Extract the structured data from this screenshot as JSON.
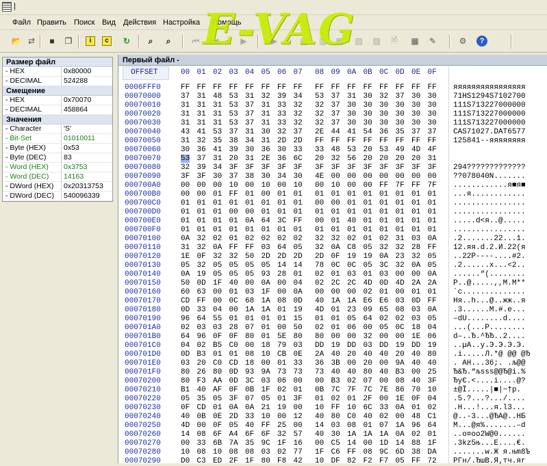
{
  "window": {
    "title": "|"
  },
  "watermark": "E-VAG",
  "menu": [
    "Файл",
    "Править",
    "Поиск",
    "Вид",
    "Действия",
    "Настройка",
    "Помощь"
  ],
  "toolbar_icons": [
    "open-file-icon",
    "compare-files-icon",
    "stop-icon",
    "copy-icon",
    "info-icon",
    "checksum-icon",
    "refresh-icon",
    "find-icon",
    "find-next-icon",
    "first-page-icon",
    "prev-page-icon",
    "prev-icon",
    "next-icon",
    "next-page-icon",
    "last-page-icon",
    "layout1-icon",
    "layout2-icon",
    "layout3-icon",
    "layout4-icon",
    "layout5-icon",
    "bookmark-icon",
    "calc-icon",
    "note-icon",
    "settings-icon",
    "help-icon"
  ],
  "left_panel": {
    "sections": [
      {
        "title": "Размер файл",
        "rows": [
          {
            "key": "- HEX",
            "value": "0x80000",
            "green": false
          },
          {
            "key": "- DECIMAL",
            "value": "524288",
            "green": false
          }
        ]
      },
      {
        "title": "Смещение",
        "rows": [
          {
            "key": "- HEX",
            "value": "0x70070",
            "green": false
          },
          {
            "key": "- DECIMAL",
            "value": "458864",
            "green": false
          }
        ]
      },
      {
        "title": "Значения",
        "rows": [
          {
            "key": "- Character",
            "value": "'S'",
            "green": false
          },
          {
            "key": "- Bit-Set",
            "value": "01010011",
            "green": true
          },
          {
            "key": "- Byte (HEX)",
            "value": "0x53",
            "green": false
          },
          {
            "key": "- Byte (DEC)",
            "value": "83",
            "green": false
          },
          {
            "key": "- Word (HEX)",
            "value": "0x3753",
            "green": true
          },
          {
            "key": "- Word (DEC)",
            "value": "14163",
            "green": true
          },
          {
            "key": "- DWord (HEX)",
            "value": "0x20313753",
            "green": false
          },
          {
            "key": "- DWord (DEC)",
            "value": "540096339",
            "green": false
          }
        ]
      }
    ]
  },
  "hex_view": {
    "title": "Первый файл -",
    "offset_header": "OFFSET",
    "columns": [
      "00",
      "01",
      "02",
      "03",
      "04",
      "05",
      "06",
      "07",
      "08",
      "09",
      "0A",
      "0B",
      "0C",
      "0D",
      "0E",
      "0F"
    ],
    "rows": [
      {
        "off": "0006FFF0",
        "bytes": "FF FF FF FF FF FF FF FF FF FF FF FF FF FF FF FF",
        "ascii": "яяяяяяяяяяяяяяяя"
      },
      {
        "off": "00070000",
        "bytes": "37 31 48 53 31 32 39 34 53 37 31 30 32 37 30 30",
        "ascii": "71HS1294S7102700"
      },
      {
        "off": "00070010",
        "bytes": "31 31 31 53 37 31 33 32 32 37 30 30 30 30 30 30",
        "ascii": "111S713227000000"
      },
      {
        "off": "00070020",
        "bytes": "31 31 31 53 37 31 33 32 32 37 30 30 30 30 30 30",
        "ascii": "111S713227000000"
      },
      {
        "off": "00070030",
        "bytes": "31 31 31 53 37 31 33 32 32 37 30 30 30 30 30 30",
        "ascii": "111S713227000000"
      },
      {
        "off": "00070040",
        "bytes": "43 41 53 37 31 30 32 37 2E 44 41 54 36 35 37 37",
        "ascii": "CAS71027.DAT6577"
      },
      {
        "off": "00070050",
        "bytes": "31 32 35 38 34 31 2D 2D FF FF FF FF FF FF FF FF",
        "ascii": "125841--яяяяяяяя"
      },
      {
        "off": "00070060",
        "bytes": "30 36 41 39 30 36 30 33 33 48 53 20 53 49 4D 4F",
        "ascii": ""
      },
      {
        "off": "00070070",
        "bytes": "53 37 31 20 31 2E 36 6C 20 32 56 20 20 20 20 31",
        "ascii": ""
      },
      {
        "off": "00070080",
        "bytes": "32 39 34 3F 3F 3F 3F 3F 3F 3F 3F 3F 3F 3F 3F 3F",
        "ascii": "294?????????????"
      },
      {
        "off": "00070090",
        "bytes": "3F 3F 30 37 38 30 34 30 4E 00 00 00 00 00 00 00",
        "ascii": "??078040N......."
      },
      {
        "off": "000700A0",
        "bytes": "00 00 00 10 00 10 00 10 00 10 00 00 FF 7F FF 7F",
        "ascii": "............я■я■"
      },
      {
        "off": "000700B0",
        "bytes": "00 00 01 FF 01 00 01 01 01 01 01 01 01 01 01 01",
        "ascii": "...я............"
      },
      {
        "off": "000700C0",
        "bytes": "01 01 01 01 01 01 01 01 00 00 01 01 01 01 01 01",
        "ascii": "................"
      },
      {
        "off": "000700D0",
        "bytes": "01 01 01 00 00 01 01 01 01 01 01 01 01 01 01 01",
        "ascii": "................"
      },
      {
        "off": "000700E0",
        "bytes": "01 01 01 01 0A 64 3C FF 00 01 40 01 01 01 01 01",
        "ascii": ".....d<я..@....."
      },
      {
        "off": "000700F0",
        "bytes": "01 01 01 01 01 01 01 01 01 01 01 01 01 01 01 01",
        "ascii": "................"
      },
      {
        "off": "00070100",
        "bytes": "0A 32 02 01 02 02 02 02 32 32 02 01 02 31 03 0A",
        "ascii": ".2.......22...1."
      },
      {
        "off": "00070110",
        "bytes": "31 32 0A FF FF 03 64 05 32 0A C8 05 32 32 28 FF",
        "ascii": "12.яя.d.2.И.22(я"
      },
      {
        "off": "00070120",
        "bytes": "1E 0F 32 32 50 2D 2D 2D 2D 0F 19 19 0A 23 32 05",
        "ascii": "..22P----....#2."
      },
      {
        "off": "00070130",
        "bytes": "05 32 05 05 05 05 14 14 78 0C 0C 05 3C 32 0A 05",
        "ascii": ".2......x...<2.."
      },
      {
        "off": "00070140",
        "bytes": "0A 19 05 05 05 93 28 01 02 01 03 01 03 00 00 0A",
        "ascii": "......“(........"
      },
      {
        "off": "00070150",
        "bytes": "50 0D 1F 40 00 0A 00 04 02 2C 2C 4D 0D 4D 2A 2A",
        "ascii": "P..@.....,,M.M**"
      },
      {
        "off": "00070160",
        "bytes": "60 63 00 01 03 1F 00 0A 00 00 00 02 01 00 01 01",
        "ascii": "`c.............."
      },
      {
        "off": "00070170",
        "bytes": "CD FF 00 0C 68 1A 08 0D 40 1A 1A E6 E6 03 0D FF",
        "ascii": "Ня..h...@..жж..я"
      },
      {
        "off": "00070180",
        "bytes": "0D 33 04 00 1A 1A 01 19 4D 01 23 09 65 08 03 0A",
        "ascii": ".3......M.#.e..."
      },
      {
        "off": "00070190",
        "bytes": "96 64 55 01 01 01 01 15 01 01 05 64 02 02 03 05",
        "ascii": "–dU........d...."
      },
      {
        "off": "000701A0",
        "bytes": "02 03 03 28 07 01 00 50 02 01 06 00 05 0C 18 04",
        "ascii": "...(...P........"
      },
      {
        "off": "000701B0",
        "bytes": "64 96 0F 0F 80 01 5E 80 80 00 00 32 00 00 1E 06",
        "ascii": "d–..Ђ.^ЂЂ..2...."
      },
      {
        "off": "000701C0",
        "bytes": "04 02 B5 C0 00 18 79 03 DD 19 DD 03 DD 19 DD 19",
        "ascii": "..µА..y.Э.Э.Э.Э."
      },
      {
        "off": "000701D0",
        "bytes": "0D B3 01 01 08 10 CB 0E 2A 40 20 40 40 20 40 80",
        "ascii": ".і.....Л.*@ @@ @Ђ"
      },
      {
        "off": "000701E0",
        "bytes": "03 20 C0 CD 18 00 01 33 36 3B 00 20 00 9A 40 40",
        "ascii": ". АН...36;. .љ@@"
      },
      {
        "off": "000701F0",
        "bytes": "80 26 80 0D 93 9A 73 73 73 40 40 80 40 B3 00 25",
        "ascii": "Ђ&Ђ.“љsss@@Ђ@і.%"
      },
      {
        "off": "00070200",
        "bytes": "80 F3 AA 0D 3C 03 06 00 00 B3 02 07 00 08 40 3F",
        "ascii": "ЂуЄ.<....і....@?"
      },
      {
        "off": "00070210",
        "bytes": "B1 40 AF 0F 0B 1F 02 01 0B 7C 7F 7C 7E 86 70 10",
        "ascii": "±@Ї.....|■|~†p."
      },
      {
        "off": "00070220",
        "bytes": "05 35 05 3F 07 05 01 3F 01 02 01 2F 00 1E 0F 04",
        "ascii": ".5.?...?.../...."
      },
      {
        "off": "00070230",
        "bytes": "0F CD 01 0A 0A 21 19 00 10 FF 10 6C 33 0A 01 02",
        "ascii": ".Н...!...я.l3..."
      },
      {
        "off": "00070240",
        "bytes": "40 0B 0E 2D 33 10 00 12 40 80 C0 40 02 00 48 C1",
        "ascii": "@..-3...@ЂА@..HБ"
      },
      {
        "off": "00070250",
        "bytes": "4D 00 0F 05 40 FF 25 00 14 03 08 01 07 1A 96 64",
        "ascii": "M...@я%.......–d"
      },
      {
        "off": "00070260",
        "bytes": "14 08 6F A4 6F 6F 32 57 40 30 1A 1A 1A 0A 02 01",
        "ascii": "..o¤oo2W@0......"
      },
      {
        "off": "00070270",
        "bytes": "00 33 6B 7A 35 9C 1F 16 00 C5 14 00 1D 14 88 1F",
        "ascii": ".3kz5њ...Е....€."
      },
      {
        "off": "00070280",
        "bytes": "10 08 10 08 08 03 02 77 1F C6 FF 08 9C 6D 38 DA",
        "ascii": ".......w.Ж я.њm8Ъ"
      },
      {
        "off": "00070290",
        "bytes": "D0 C3 ED 2F 1F 80 F8 42 10 DF 82 F2 F7 05 FF 72",
        "ascii": "РГн/.ЂшB.Я‚тч.яr"
      }
    ]
  }
}
